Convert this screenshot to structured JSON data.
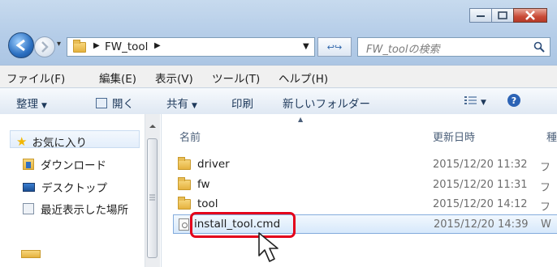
{
  "window": {
    "path_segment": "FW_tool",
    "search_placeholder": "FW_toolの検索"
  },
  "menu": [
    "ファイル(F)",
    "編集(E)",
    "表示(V)",
    "ツール(T)",
    "ヘルプ(H)"
  ],
  "toolbar": {
    "organize": "整理",
    "open": "開く",
    "share": "共有",
    "print": "印刷",
    "new_folder": "新しいフォルダー"
  },
  "nav_pane": {
    "favorites": "お気に入り",
    "downloads": "ダウンロード",
    "desktop": "デスクトップ",
    "recent": "最近表示した場所"
  },
  "columns": {
    "name": "名前",
    "date": "更新日時",
    "type": "種"
  },
  "files": [
    {
      "name": "driver",
      "date": "2015/12/20 11:32",
      "type": "フ",
      "kind": "folder"
    },
    {
      "name": "fw",
      "date": "2015/12/20 11:31",
      "type": "フ",
      "kind": "folder"
    },
    {
      "name": "tool",
      "date": "2015/12/20 14:12",
      "type": "フ",
      "kind": "folder"
    },
    {
      "name": "install_tool.cmd",
      "date": "2015/12/20 14:39",
      "type": "W",
      "kind": "cmd"
    }
  ]
}
